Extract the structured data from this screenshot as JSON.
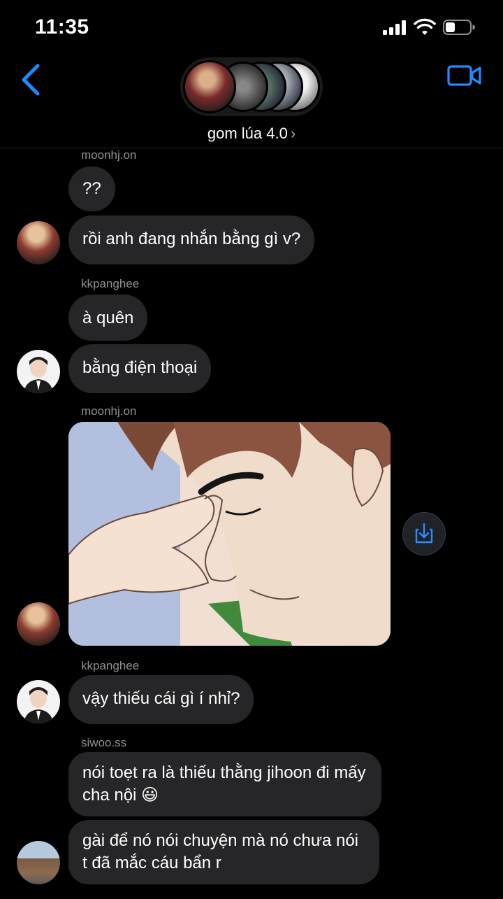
{
  "status_bar": {
    "time": "11:35"
  },
  "header": {
    "group_name": "gom lúa 4.0",
    "chevron": "›"
  },
  "messages": [
    {
      "sender": "moonhj.on",
      "text": "??"
    },
    {
      "text": "rồi anh đang nhắn bằng gì v?"
    },
    {
      "sender": "kkpanghee",
      "text": "à quên"
    },
    {
      "text": "bằng điện thoại"
    },
    {
      "sender": "moonhj.on",
      "type": "image"
    },
    {
      "sender": "kkpanghee",
      "text": "vậy thiếu cái gì í nhỉ?"
    },
    {
      "sender": "siwoo.ss",
      "text": "nói toẹt ra là thiếu thằng jihoon đi mấy cha nội 😃"
    },
    {
      "text": "gài để nó nói chuyện mà nó chưa nói t đã mắc cáu bẩn r"
    }
  ],
  "icons": {
    "back": "chevron-left-icon",
    "video": "video-camera-icon",
    "share": "download-share-icon"
  },
  "colors": {
    "accent": "#1e8bff",
    "bubble": "#262628",
    "background": "#000000"
  }
}
